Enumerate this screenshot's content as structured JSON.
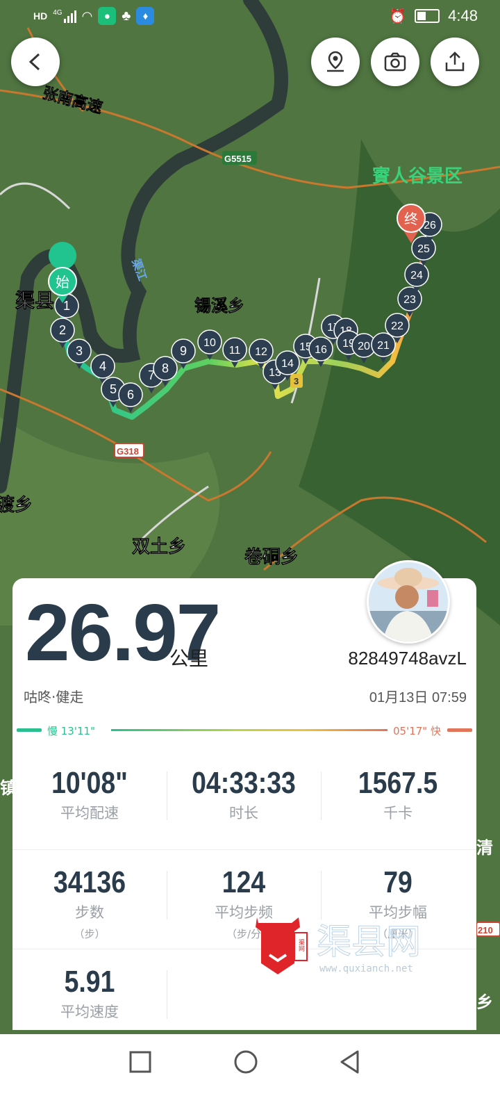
{
  "status_bar": {
    "left_icons": [
      "hd-icon",
      "signal-4g-icon",
      "wifi-icon",
      "green-app-icon",
      "qq-icon",
      "lightbulb-app-icon"
    ],
    "left_labels": {
      "hd": "HD",
      "net": "4G"
    },
    "time": "4:48",
    "right_icons": [
      "alarm-icon",
      "battery-icon"
    ]
  },
  "toolbar": {
    "back_icon": "chevron-left-icon",
    "actions": [
      "location-pin-icon",
      "camera-icon",
      "share-icon"
    ]
  },
  "map": {
    "labels": {
      "highway": "张南高速",
      "g5515": "G5515",
      "scenic": "賨人谷景区",
      "county": "渠县",
      "river": "渠江",
      "xixi": "锡溪乡",
      "g318": "G318",
      "dudu": "渡乡",
      "shuangtu": "双土乡",
      "juantong": "卷硐乡",
      "start": "始",
      "end": "终",
      "edge1": "镇",
      "edge2": "清",
      "edge3": "210",
      "edge4": "乡",
      "road3": "3"
    },
    "markers": [
      "1",
      "2",
      "3",
      "4",
      "5",
      "6",
      "7",
      "8",
      "9",
      "10",
      "11",
      "12",
      "13",
      "14",
      "15",
      "16",
      "17",
      "18",
      "19",
      "20",
      "21",
      "22",
      "23",
      "24",
      "25",
      "26"
    ]
  },
  "summary": {
    "distance": "26.97",
    "distance_unit": "公里",
    "user_id": "82849748avzL",
    "activity": "咕咚·健走",
    "datetime": "01月13日 07:59",
    "pace_slow": "慢 13'11\"",
    "pace_fast": "05'17\" 快"
  },
  "stats": [
    {
      "value": "10'08\"",
      "label": "平均配速",
      "unit": ""
    },
    {
      "value": "04:33:33",
      "label": "时长",
      "unit": ""
    },
    {
      "value": "1567.5",
      "label": "千卡",
      "unit": ""
    },
    {
      "value": "34136",
      "label": "步数",
      "unit": "（步）"
    },
    {
      "value": "124",
      "label": "平均步频",
      "unit": "（步/分"
    },
    {
      "value": "79",
      "label": "平均步幅",
      "unit": "（厘米）"
    },
    {
      "value": "5.91",
      "label": "平均速度",
      "unit": ""
    }
  ],
  "watermark": {
    "text": "渠县网",
    "url": "www.quxianch.net",
    "seal": "渠网"
  },
  "nav": [
    "recent-apps-icon",
    "home-icon",
    "back-triangle-icon"
  ],
  "colors": {
    "slow": "#2bbf8f",
    "fast": "#e2745a",
    "start_marker": "#21c38f",
    "end_marker": "#e2624f",
    "marker": "#2d3e50"
  }
}
